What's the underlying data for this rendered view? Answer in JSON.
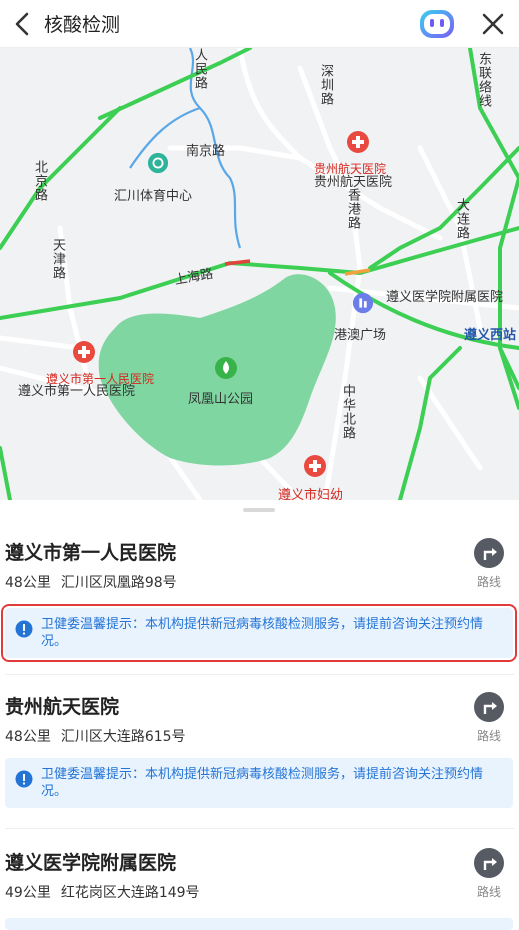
{
  "header": {
    "title": "核酸检测"
  },
  "map": {
    "labels": {
      "renmin_road": "人民路",
      "shenzhen_road": "深圳路",
      "dongfeng_road": "东联络线",
      "nanjing_road": "南京路",
      "huichuan_sports": "汇川体育中心",
      "aerospace_red": "贵州航天医院",
      "aerospace": "贵州航天医院",
      "hongkong_road": "香港路",
      "dalian_road": "大连路",
      "beijing_road": "北京路",
      "tianjin_road": "天津路",
      "shanghai_road": "上海路",
      "zunyi_medical": "遵义医学院附属医院",
      "zunyi_west": "遵义西站",
      "gangao": "港澳广场",
      "first_hospital_red": "遵义市第一人民医院",
      "first_hospital": "遵义市第一人民医院",
      "fenghuang": "凤凰山公园",
      "zhonghua_road": "中华北路",
      "maternal": "遵义市妇幼"
    }
  },
  "notice_text": "卫健委温馨提示：本机构提供新冠病毒核酸检测服务，请提前咨询关注预约情况。",
  "route_label": "路线",
  "results": [
    {
      "name": "遵义市第一人民医院",
      "distance": "48公里",
      "address": "汇川区凤凰路98号"
    },
    {
      "name": "贵州航天医院",
      "distance": "48公里",
      "address": "汇川区大连路615号"
    },
    {
      "name": "遵义医学院附属医院",
      "distance": "49公里",
      "address": "红花岗区大连路149号"
    }
  ],
  "colors": {
    "road_green": "#3ccf54",
    "park_green": "#7fd6a0",
    "hospital_red": "#e84a3f",
    "notice_bg": "#e8f3fd",
    "notice_text": "#2474d6",
    "highlight_border": "#e23b3b"
  }
}
